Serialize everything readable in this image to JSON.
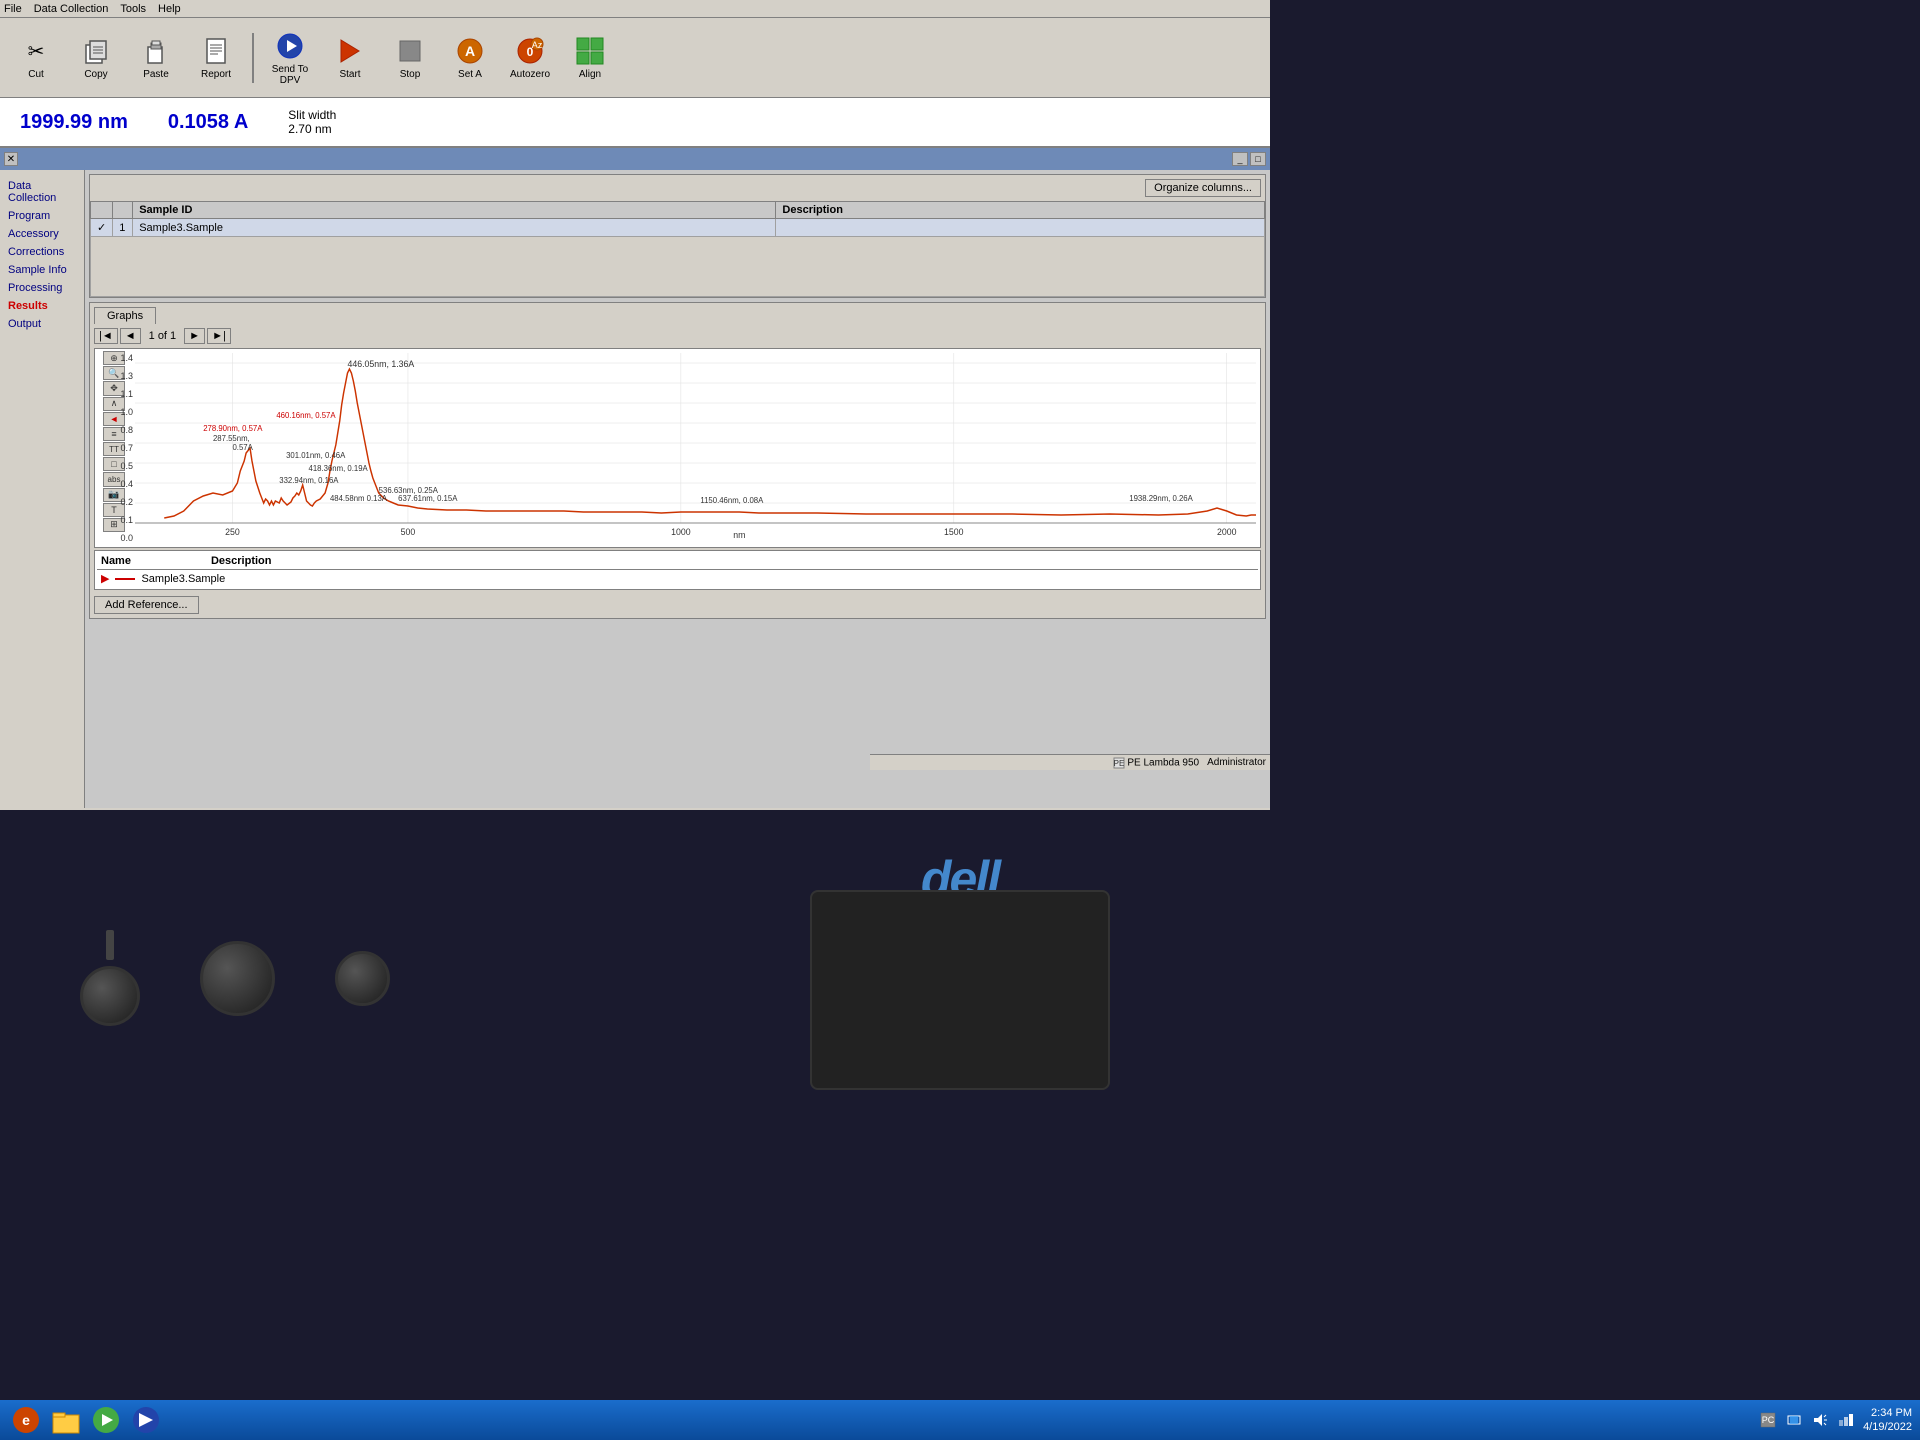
{
  "app": {
    "title": "PE Lambda 950",
    "menu_items": [
      "File",
      "Data Collection",
      "Tools",
      "Help"
    ]
  },
  "toolbar": {
    "buttons": [
      {
        "name": "cut",
        "label": "Cut",
        "icon": "✂"
      },
      {
        "name": "copy",
        "label": "Copy",
        "icon": "📋"
      },
      {
        "name": "paste",
        "label": "Paste",
        "icon": "📌"
      },
      {
        "name": "report",
        "label": "Report",
        "icon": "📄"
      },
      {
        "name": "send-to-dpv",
        "label": "Send To DPV",
        "icon": "▶"
      },
      {
        "name": "start",
        "label": "Start",
        "icon": "▶"
      },
      {
        "name": "stop",
        "label": "Stop",
        "icon": "⬛"
      },
      {
        "name": "set-a",
        "label": "Set A",
        "icon": "A"
      },
      {
        "name": "autozero",
        "label": "Autozero",
        "icon": "⊕"
      },
      {
        "name": "align",
        "label": "Align",
        "icon": "⊞"
      }
    ]
  },
  "status": {
    "wavelength": "1999.99 nm",
    "absorbance": "0.1058 A",
    "slit_label": "Slit width",
    "slit_value": "2.70 nm"
  },
  "sidebar": {
    "items": [
      {
        "label": "Data Collection",
        "active": false
      },
      {
        "label": "Program",
        "active": false
      },
      {
        "label": "Accessory",
        "active": false
      },
      {
        "label": "Corrections",
        "active": false
      },
      {
        "label": "Sample Info",
        "active": false
      },
      {
        "label": "Processing",
        "active": false
      },
      {
        "label": "Results",
        "active": true
      },
      {
        "label": "Output",
        "active": false
      }
    ]
  },
  "sample_table": {
    "organize_btn": "Organize columns...",
    "columns": [
      "Sample ID",
      "Description"
    ],
    "rows": [
      {
        "checked": true,
        "number": "1",
        "sample_id": "Sample3.Sample",
        "description": ""
      }
    ]
  },
  "graphs": {
    "tab_label": "Graphs",
    "pagination": "1 of 1",
    "x_axis_labels": [
      "250",
      "500",
      "1000",
      "1500",
      "2000"
    ],
    "x_axis_unit": "nm",
    "y_axis_labels": [
      "1.4",
      "1.3",
      "1.1",
      "1.0",
      "0.8",
      "0.7",
      "0.5",
      "0.4",
      "0.2",
      "0.1",
      "0.0"
    ],
    "data_points": [
      {
        "nm": "287.55nm",
        "A": "0.57A"
      },
      {
        "nm": "446.05nm",
        "A": "1.36A"
      },
      {
        "nm": "301.01nm",
        "A": "0.46A"
      },
      {
        "nm": "418.36nm",
        "A": "0.19A"
      },
      {
        "nm": "536.63nm",
        "A": "0.25A"
      },
      {
        "nm": "332.94nm",
        "A": "0.16A"
      },
      {
        "nm": "484.58nm",
        "A": "0.13A"
      },
      {
        "nm": "637.61nm",
        "A": "0.15A"
      },
      {
        "nm": "1150.46nm",
        "A": "0.08A"
      },
      {
        "nm": "1938.29nm",
        "A": "0.26A"
      },
      {
        "nm": "278.90nm",
        "A": "0.57A"
      },
      {
        "nm": "460.16nm",
        "A": "0.57A"
      }
    ],
    "legend": {
      "columns": [
        "Name",
        "Description"
      ],
      "rows": [
        {
          "name": "Sample3.Sample",
          "description": ""
        }
      ]
    },
    "add_ref_btn": "Add Reference..."
  },
  "app_status": {
    "software": "PE Lambda 950",
    "user": "Administrator"
  },
  "taskbar": {
    "time": "2:34 PM",
    "date": "4/19/2022"
  }
}
